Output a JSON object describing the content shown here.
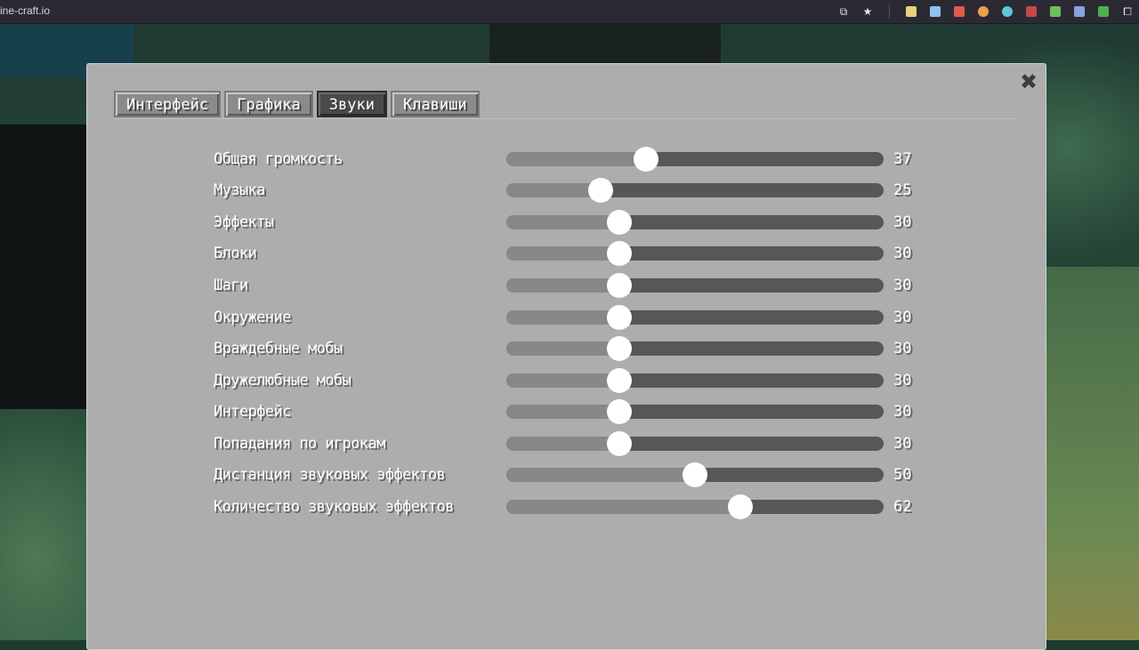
{
  "browser": {
    "url": "ine-craft.io",
    "icons": [
      "install-app-icon",
      "bookmark-star-icon",
      "extension-1-icon",
      "extension-2-icon",
      "extension-3-icon",
      "extension-4-icon",
      "extension-5-icon",
      "extension-6-icon",
      "extension-7-icon",
      "extension-8-icon",
      "extension-9-icon",
      "extensions-puzzle-icon"
    ]
  },
  "settings": {
    "close_glyph": "✖",
    "tabs": [
      {
        "label": "Интерфейс",
        "active": false
      },
      {
        "label": "Графика",
        "active": false
      },
      {
        "label": "Звуки",
        "active": true
      },
      {
        "label": "Клавиши",
        "active": false
      }
    ],
    "sliders": [
      {
        "label": "Общая громкость",
        "value": "37"
      },
      {
        "label": "Музыка",
        "value": "25"
      },
      {
        "label": "Эффекты",
        "value": "30"
      },
      {
        "label": "Блоки",
        "value": "30"
      },
      {
        "label": "Шаги",
        "value": "30"
      },
      {
        "label": "Окружение",
        "value": "30"
      },
      {
        "label": "Враждебные мобы",
        "value": "30"
      },
      {
        "label": "Дружелюбные мобы",
        "value": "30"
      },
      {
        "label": "Интерфейс",
        "value": "30"
      },
      {
        "label": "Попадания по игрокам",
        "value": "30"
      },
      {
        "label": "Дистанция звуковых эффектов",
        "value": "50"
      },
      {
        "label": "Количество звуковых эффектов",
        "value": "62"
      }
    ]
  },
  "colors": {
    "panel": "#adadad",
    "slider_track": "#575757",
    "slider_fill": "#888888",
    "knob": "#ffffff",
    "active_tab": "#4a4a4a"
  }
}
